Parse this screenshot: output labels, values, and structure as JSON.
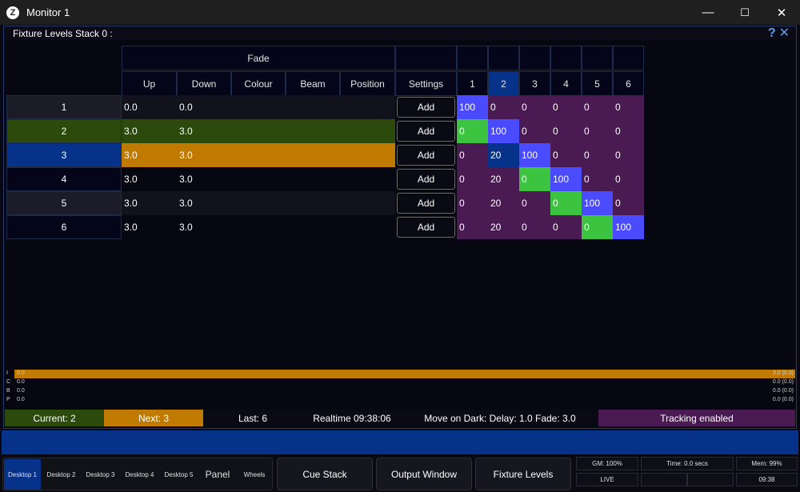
{
  "window": {
    "app_icon": "Z",
    "title": "Monitor 1",
    "minimize": "—",
    "maximize": "☐",
    "close": "✕"
  },
  "panel": {
    "title": "Fixture Levels Stack 0 :",
    "help_icon": "?",
    "close_icon": "✕"
  },
  "table": {
    "fade_group": "Fade",
    "columns": [
      "Up",
      "Down",
      "Colour",
      "Beam",
      "Position"
    ],
    "settings": "Settings",
    "fixtures": [
      "1",
      "2",
      "3",
      "4",
      "5",
      "6"
    ],
    "active_fixture": "2",
    "add_label": "Add",
    "rows": [
      {
        "cue": "1",
        "up": "0.0",
        "down": "0.0",
        "levels": [
          "100",
          "0",
          "0",
          "0",
          "0",
          "0"
        ]
      },
      {
        "cue": "2",
        "up": "3.0",
        "down": "3.0",
        "levels": [
          "0",
          "100",
          "0",
          "0",
          "0",
          "0"
        ]
      },
      {
        "cue": "3",
        "up": "3.0",
        "down": "3.0",
        "levels": [
          "0",
          "20",
          "100",
          "0",
          "0",
          "0"
        ]
      },
      {
        "cue": "4",
        "up": "3.0",
        "down": "3.0",
        "levels": [
          "0",
          "20",
          "0",
          "100",
          "0",
          "0"
        ]
      },
      {
        "cue": "5",
        "up": "3.0",
        "down": "3.0",
        "levels": [
          "0",
          "20",
          "0",
          "0",
          "100",
          "0"
        ]
      },
      {
        "cue": "6",
        "up": "3.0",
        "down": "3.0",
        "levels": [
          "0",
          "20",
          "0",
          "0",
          "0",
          "100"
        ]
      }
    ]
  },
  "levelbars": [
    {
      "tag": "I",
      "left": "0.0",
      "right": "3.0 (0.0)",
      "progress": 1.0
    },
    {
      "tag": "C",
      "left": "0.0",
      "right": "0.0 (0.0)",
      "progress": 0
    },
    {
      "tag": "B",
      "left": "0.0",
      "right": "0.0 (0.0)",
      "progress": 0
    },
    {
      "tag": "P",
      "left": "0.0",
      "right": "0.0 (0.0)",
      "progress": 0
    }
  ],
  "status": {
    "current": "Current: 2",
    "next": "Next: 3",
    "last": "Last: 6",
    "realtime": "Realtime 09:38:06",
    "move_on_dark": "Move on Dark: Delay: 1.0  Fade: 3.0",
    "tracking": "Tracking enabled"
  },
  "toolbar": {
    "desktops": [
      "Desktop 1",
      "Desktop 2",
      "Desktop 3",
      "Desktop 4",
      "Desktop 5"
    ],
    "panel": "Panel",
    "wheels": "Wheels",
    "cue_stack": "Cue Stack",
    "output_window": "Output Window",
    "fixture_levels": "Fixture Levels"
  },
  "info": {
    "gm": "GM: 100%",
    "time": "Time: 0.0 secs",
    "mem": "Mem: 99%",
    "live": "LIVE",
    "clock": "09:38"
  },
  "colors": {
    "cue_active_row": "#2c4a0c",
    "cue_current_row": "#07328a",
    "next_row": "#c07a00",
    "level_purple": "#4a1b52",
    "level_full": "#4a4aff",
    "level_green": "#3cc440",
    "level_navy": "#07328a"
  }
}
